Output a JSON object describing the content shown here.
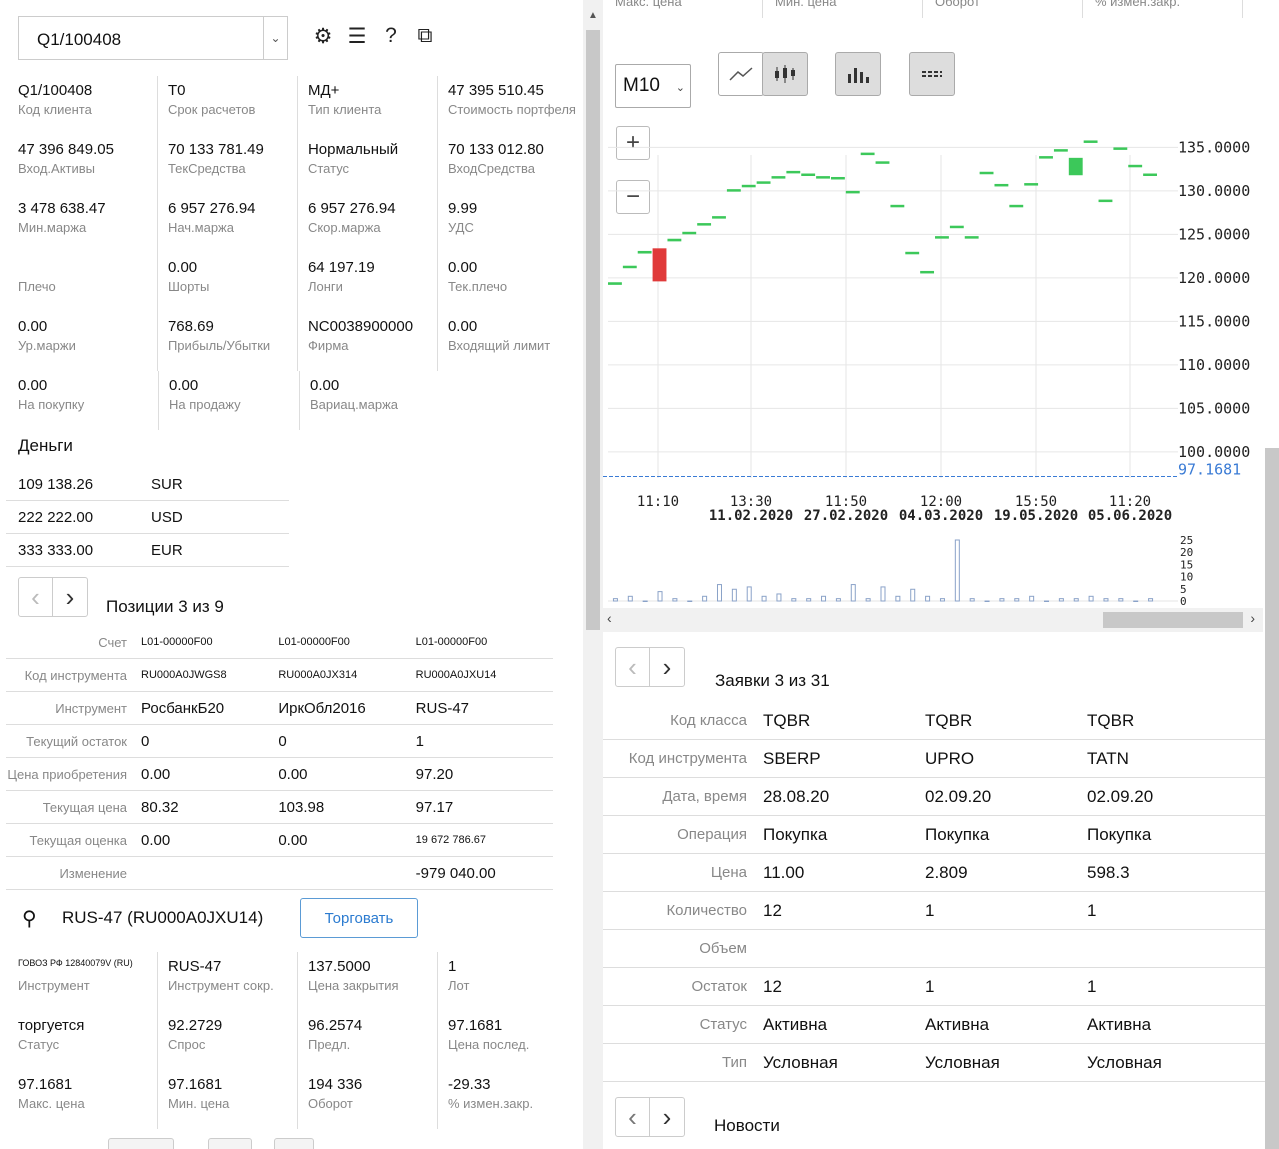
{
  "left": {
    "account_select": "Q1/100408",
    "icons": [
      "gear-icon",
      "list-icon",
      "help-icon",
      "external-link-icon"
    ],
    "summary": [
      [
        {
          "v": "Q1/100408",
          "l": "Код клиента"
        },
        {
          "v": "T0",
          "l": "Срок расчетов"
        },
        {
          "v": "МД+",
          "l": "Тип клиента"
        },
        {
          "v": "47 395 510.45",
          "l": "Стоимость портфеля"
        }
      ],
      [
        {
          "v": "47 396 849.05",
          "l": "Вход.Активы"
        },
        {
          "v": "70 133 781.49",
          "l": "ТекСредства"
        },
        {
          "v": "Нормальный",
          "l": "Статус"
        },
        {
          "v": "70 133 012.80",
          "l": "ВходСредства"
        }
      ],
      [
        {
          "v": "3 478 638.47",
          "l": "Мин.маржа"
        },
        {
          "v": "6 957 276.94",
          "l": "Нач.маржа"
        },
        {
          "v": "6 957 276.94",
          "l": "Скор.маржа"
        },
        {
          "v": "9.99",
          "l": "УДС"
        }
      ],
      [
        {
          "v": "",
          "l": "Плечо"
        },
        {
          "v": "0.00",
          "l": "Шорты"
        },
        {
          "v": "64 197.19",
          "l": "Лонги"
        },
        {
          "v": "0.00",
          "l": "Тек.плечо"
        }
      ],
      [
        {
          "v": "0.00",
          "l": "Ур.маржи"
        },
        {
          "v": "768.69",
          "l": "Прибыль/Убытки"
        },
        {
          "v": "NC0038900000",
          "l": "Фирма"
        },
        {
          "v": "0.00",
          "l": "Входящий лимит"
        }
      ],
      [
        {
          "v": "0.00",
          "l": "На покупку"
        },
        {
          "v": "0.00",
          "l": "На продажу"
        },
        {
          "v": "0.00",
          "l": "Вариац.маржа"
        }
      ]
    ],
    "money_title": "Деньги",
    "money": [
      {
        "amount": "109 138.26",
        "currency": "SUR"
      },
      {
        "amount": "222 222.00",
        "currency": "USD"
      },
      {
        "amount": "333 333.00",
        "currency": "EUR"
      }
    ],
    "positions_title": "Позиции 3 из 9",
    "positions": [
      {
        "label": "Счет",
        "values": [
          "L01-00000F00",
          "L01-00000F00",
          "L01-00000F00"
        ],
        "small": true
      },
      {
        "label": "Код инструмента",
        "values": [
          "RU000A0JWGS8",
          "RU000A0JX314",
          "RU000A0JXU14"
        ],
        "small": true
      },
      {
        "label": "Инструмент",
        "values": [
          "РосбанкБ20",
          "ИркОбл2016",
          "RUS-47"
        ]
      },
      {
        "label": "Текущий остаток",
        "values": [
          "0",
          "0",
          "1"
        ]
      },
      {
        "label": "Цена приобретения",
        "values": [
          "0.00",
          "0.00",
          "97.20"
        ]
      },
      {
        "label": "Текущая цена",
        "values": [
          "80.32",
          "103.98",
          "97.17"
        ]
      },
      {
        "label": "Текущая оценка",
        "values": [
          "0.00",
          "0.00",
          "19 672 786.67"
        ],
        "small_last": true
      },
      {
        "label": "Изменение",
        "values": [
          "",
          "",
          "-979 040.00"
        ]
      }
    ],
    "search_text": "RUS-47 (RU000A0JXU14)",
    "trade_button": "Торговать",
    "instrument": [
      [
        {
          "v": "ГОВОЗ РФ 12840079V (RU)",
          "l": "Инструмент",
          "tiny": true
        },
        {
          "v": "RUS-47",
          "l": "Инструмент сокр."
        },
        {
          "v": "137.5000",
          "l": "Цена закрытия"
        },
        {
          "v": "1",
          "l": "Лот"
        }
      ],
      [
        {
          "v": "торгуется",
          "l": "Статус"
        },
        {
          "v": "92.2729",
          "l": "Спрос"
        },
        {
          "v": "96.2574",
          "l": "Предл."
        },
        {
          "v": "97.1681",
          "l": "Цена послед."
        }
      ],
      [
        {
          "v": "97.1681",
          "l": "Макс. цена"
        },
        {
          "v": "97.1681",
          "l": "Мин. цена"
        },
        {
          "v": "194 336",
          "l": "Оборот"
        },
        {
          "v": "-29.33",
          "l": "% измен.закр."
        }
      ]
    ]
  },
  "right": {
    "top_labels": [
      "Макс. цена",
      "Мин. цена",
      "Оборот",
      "% измен.закр."
    ],
    "timeframe": "M10",
    "tools": {
      "line_icon": "line-chart-icon",
      "candle_icon": "candlestick-icon",
      "volume_icon": "volume-bars-icon",
      "level_icon": "horizontal-lines-icon"
    },
    "zoom_in": "+",
    "zoom_out": "−",
    "orders_title": "Заявки 3 из 31",
    "orders": [
      {
        "label": "Код класса",
        "values": [
          "TQBR",
          "TQBR",
          "TQBR"
        ]
      },
      {
        "label": "Код инструмента",
        "values": [
          "SBERP",
          "UPRO",
          "TATN"
        ]
      },
      {
        "label": "Дата, время",
        "values": [
          "28.08.20",
          "02.09.20",
          "02.09.20"
        ]
      },
      {
        "label": "Операция",
        "values": [
          "Покупка",
          "Покупка",
          "Покупка"
        ]
      },
      {
        "label": "Цена",
        "values": [
          "11.00",
          "2.809",
          "598.3"
        ]
      },
      {
        "label": "Количество",
        "values": [
          "12",
          "1",
          "1"
        ]
      },
      {
        "label": "Объем",
        "values": [
          "",
          "",
          ""
        ]
      },
      {
        "label": "Остаток",
        "values": [
          "12",
          "1",
          "1"
        ]
      },
      {
        "label": "Статус",
        "values": [
          "Активна",
          "Активна",
          "Активна"
        ]
      },
      {
        "label": "Тип",
        "values": [
          "Условная",
          "Условная",
          "Условная"
        ]
      }
    ],
    "news_title": "Новости"
  },
  "chart_data": {
    "type": "candlestick",
    "price_ticks": [
      "135.0000",
      "130.0000",
      "125.0000",
      "120.0000",
      "115.0000",
      "110.0000",
      "105.0000",
      "100.0000"
    ],
    "last_price_label": "97.1681",
    "last_price": 97.1681,
    "x_ticks": [
      {
        "time": "11:10",
        "date": ""
      },
      {
        "time": "13:30",
        "date": "11.02.2020"
      },
      {
        "time": "11:50",
        "date": "27.02.2020"
      },
      {
        "time": "12:00",
        "date": "04.03.2020"
      },
      {
        "time": "15:50",
        "date": "19.05.2020"
      },
      {
        "time": "11:20",
        "date": "05.06.2020"
      }
    ],
    "volume_ticks": [
      "25",
      "20",
      "15",
      "10",
      "5",
      "0"
    ],
    "ylim": [
      97,
      137
    ],
    "up_color": "#3cc85a",
    "down_color": "#e03a3a",
    "candles": [
      {
        "i": 0,
        "o": 119.2,
        "c": 119.5,
        "h": 119.5,
        "l": 119.2
      },
      {
        "i": 1,
        "o": 121.2,
        "c": 121.4,
        "h": 121.4,
        "l": 121.2
      },
      {
        "i": 2,
        "o": 122.8,
        "c": 123.1,
        "h": 123.1,
        "l": 122.8
      },
      {
        "i": 3,
        "o": 123.4,
        "c": 119.6,
        "h": 123.4,
        "l": 119.6
      },
      {
        "i": 4,
        "o": 124.2,
        "c": 124.5,
        "h": 124.5,
        "l": 124.2
      },
      {
        "i": 5,
        "o": 125.1,
        "c": 125.3,
        "h": 125.3,
        "l": 125.1
      },
      {
        "i": 6,
        "o": 126.1,
        "c": 126.3,
        "h": 126.3,
        "l": 126.1
      },
      {
        "i": 7,
        "o": 126.9,
        "c": 127.1,
        "h": 127.1,
        "l": 126.9
      },
      {
        "i": 8,
        "o": 130.0,
        "c": 130.2,
        "h": 130.2,
        "l": 130.0
      },
      {
        "i": 9,
        "o": 130.5,
        "c": 130.7,
        "h": 130.7,
        "l": 130.5
      },
      {
        "i": 10,
        "o": 130.9,
        "c": 131.1,
        "h": 131.1,
        "l": 130.9
      },
      {
        "i": 11,
        "o": 131.5,
        "c": 131.7,
        "h": 131.7,
        "l": 131.5
      },
      {
        "i": 12,
        "o": 132.1,
        "c": 132.3,
        "h": 132.3,
        "l": 132.1
      },
      {
        "i": 13,
        "o": 131.8,
        "c": 132.0,
        "h": 132.0,
        "l": 131.8
      },
      {
        "i": 14,
        "o": 131.5,
        "c": 131.7,
        "h": 131.7,
        "l": 131.5
      },
      {
        "i": 15,
        "o": 131.4,
        "c": 131.6,
        "h": 131.6,
        "l": 131.4
      },
      {
        "i": 16,
        "o": 129.8,
        "c": 130.0,
        "h": 130.0,
        "l": 129.8
      },
      {
        "i": 17,
        "o": 134.2,
        "c": 134.4,
        "h": 134.4,
        "l": 134.2
      },
      {
        "i": 18,
        "o": 133.2,
        "c": 133.4,
        "h": 133.4,
        "l": 133.2
      },
      {
        "i": 19,
        "o": 128.2,
        "c": 128.4,
        "h": 128.4,
        "l": 128.2
      },
      {
        "i": 20,
        "o": 122.8,
        "c": 123.0,
        "h": 123.0,
        "l": 122.8
      },
      {
        "i": 21,
        "o": 120.6,
        "c": 120.8,
        "h": 120.8,
        "l": 120.6
      },
      {
        "i": 22,
        "o": 124.6,
        "c": 124.8,
        "h": 124.8,
        "l": 124.6
      },
      {
        "i": 23,
        "o": 125.8,
        "c": 126.0,
        "h": 126.0,
        "l": 125.8
      },
      {
        "i": 24,
        "o": 124.6,
        "c": 124.8,
        "h": 124.8,
        "l": 124.6
      },
      {
        "i": 25,
        "o": 132.0,
        "c": 132.2,
        "h": 132.2,
        "l": 132.0
      },
      {
        "i": 26,
        "o": 130.6,
        "c": 130.8,
        "h": 130.8,
        "l": 130.6
      },
      {
        "i": 27,
        "o": 128.2,
        "c": 128.4,
        "h": 128.4,
        "l": 128.2
      },
      {
        "i": 28,
        "o": 130.7,
        "c": 130.9,
        "h": 130.9,
        "l": 130.7
      },
      {
        "i": 29,
        "o": 133.8,
        "c": 134.0,
        "h": 134.0,
        "l": 133.8
      },
      {
        "i": 30,
        "o": 134.6,
        "c": 134.8,
        "h": 134.8,
        "l": 134.6
      },
      {
        "i": 31,
        "o": 131.8,
        "c": 133.8,
        "h": 133.8,
        "l": 131.8
      },
      {
        "i": 32,
        "o": 135.6,
        "c": 135.8,
        "h": 135.8,
        "l": 135.6
      },
      {
        "i": 33,
        "o": 128.8,
        "c": 129.0,
        "h": 129.0,
        "l": 128.8
      },
      {
        "i": 34,
        "o": 134.8,
        "c": 135.0,
        "h": 135.0,
        "l": 134.8
      },
      {
        "i": 35,
        "o": 132.8,
        "c": 133.0,
        "h": 133.0,
        "l": 132.8
      },
      {
        "i": 36,
        "o": 131.8,
        "c": 132.0,
        "h": 132.0,
        "l": 131.8
      }
    ],
    "volumes": [
      1,
      2,
      0,
      4,
      1,
      0,
      2,
      7,
      5,
      6,
      2,
      3,
      1,
      1,
      2,
      1,
      7,
      1,
      6,
      2,
      5,
      2,
      1,
      26,
      1,
      0,
      1,
      1,
      2,
      0,
      1,
      1,
      2,
      1,
      1,
      0,
      1
    ]
  }
}
